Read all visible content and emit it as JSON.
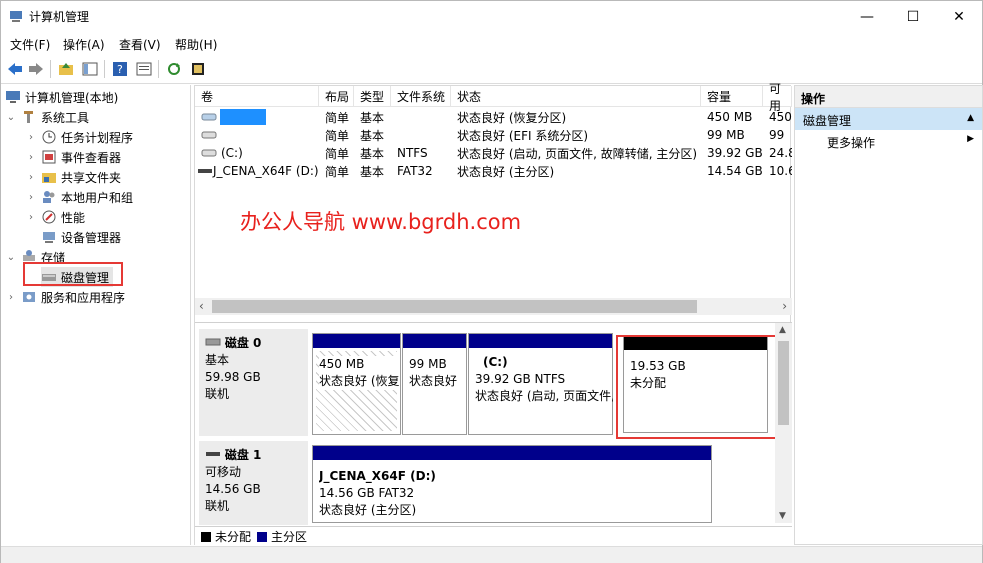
{
  "window": {
    "title": "计算机管理"
  },
  "menu": [
    "文件(F)",
    "操作(A)",
    "查看(V)",
    "帮助(H)"
  ],
  "tree": {
    "root": "计算机管理(本地)",
    "system_tools": "系统工具",
    "task_scheduler": "任务计划程序",
    "event_viewer": "事件查看器",
    "shared_folders": "共享文件夹",
    "local_users": "本地用户和组",
    "performance": "性能",
    "device_manager": "设备管理器",
    "storage": "存储",
    "disk_management": "磁盘管理",
    "services": "服务和应用程序"
  },
  "volumes": {
    "headers": [
      "卷",
      "布局",
      "类型",
      "文件系统",
      "状态",
      "容量",
      "可用"
    ],
    "rows": [
      {
        "name": "",
        "layout": "简单",
        "type": "基本",
        "fs": "",
        "status": "状态良好 (恢复分区)",
        "capacity": "450 MB",
        "free": "450"
      },
      {
        "name": "",
        "layout": "简单",
        "type": "基本",
        "fs": "",
        "status": "状态良好 (EFI 系统分区)",
        "capacity": "99 MB",
        "free": "99"
      },
      {
        "name": "(C:)",
        "layout": "简单",
        "type": "基本",
        "fs": "NTFS",
        "status": "状态良好 (启动, 页面文件, 故障转储, 主分区)",
        "capacity": "39.92 GB",
        "free": "24.8"
      },
      {
        "name": "J_CENA_X64F (D:)",
        "layout": "简单",
        "type": "基本",
        "fs": "FAT32",
        "status": "状态良好 (主分区)",
        "capacity": "14.54 GB",
        "free": "10.6"
      }
    ]
  },
  "watermark": "办公人导航 www.bgrdh.com",
  "disk0": {
    "name": "磁盘 0",
    "kind": "基本",
    "size": "59.98 GB",
    "state": "联机",
    "parts": [
      {
        "l1": "",
        "l2": "450 MB",
        "l3": "状态良好 (恢复"
      },
      {
        "l1": "",
        "l2": "99 MB",
        "l3": "状态良好"
      },
      {
        "l1": "(C:)",
        "l2": "39.92 GB NTFS",
        "l3": "状态良好 (启动, 页面文件,"
      },
      {
        "l1": "",
        "l2": "19.53 GB",
        "l3": "未分配"
      }
    ]
  },
  "disk1": {
    "name": "磁盘 1",
    "kind": "可移动",
    "size": "14.56 GB",
    "state": "联机",
    "part": {
      "l1": "J_CENA_X64F  (D:)",
      "l2": "14.56 GB FAT32",
      "l3": "状态良好 (主分区)"
    }
  },
  "legend": {
    "unalloc": "未分配",
    "primary": "主分区"
  },
  "actions": {
    "header": "操作",
    "selected": "磁盘管理",
    "more": "更多操作"
  },
  "colors": {
    "primary_bar": "#00008b",
    "unalloc_bar": "#000000",
    "highlight": "#e53935",
    "watermark": "#e8211d"
  }
}
